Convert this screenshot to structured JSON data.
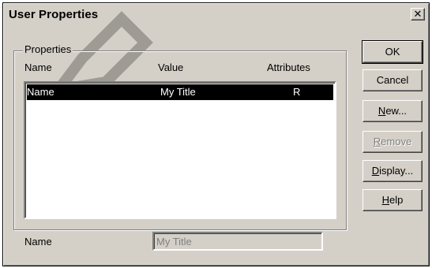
{
  "dialog": {
    "title": "User Properties",
    "close_glyph": "✕"
  },
  "properties": {
    "group_label": "Properties",
    "columns": {
      "name": "Name",
      "value": "Value",
      "attributes": "Attributes"
    },
    "rows": [
      {
        "name": "Name",
        "value": "My Title",
        "attributes": "R",
        "selected": true
      }
    ]
  },
  "name_field": {
    "label": "Name",
    "value": "My Title",
    "disabled": true
  },
  "buttons": {
    "ok": "OK",
    "cancel": "Cancel",
    "new_prefix": "",
    "new_mnemonic": "N",
    "new_rest": "ew...",
    "remove_prefix": "",
    "remove_mnemonic": "R",
    "remove_rest": "emove",
    "display_prefix": "",
    "display_mnemonic": "D",
    "display_rest": "isplay...",
    "help_prefix": "",
    "help_mnemonic": "H",
    "help_rest": "elp"
  },
  "colors": {
    "face": "#d4d0c8",
    "selection": "#000000",
    "disabled_text": "#808080"
  }
}
